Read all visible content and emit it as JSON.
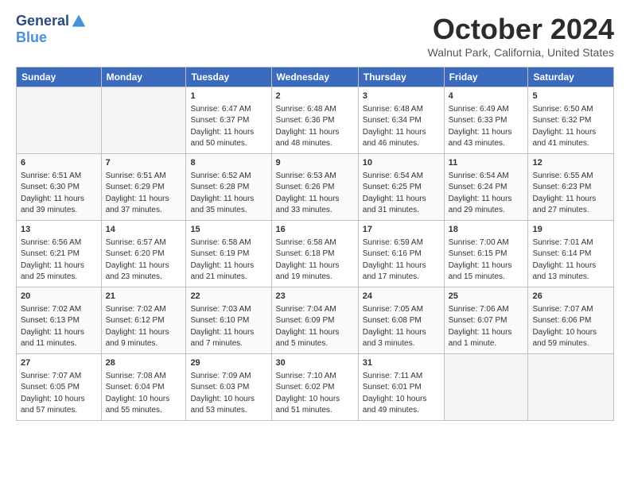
{
  "header": {
    "logo_general": "General",
    "logo_blue": "Blue",
    "month_title": "October 2024",
    "location": "Walnut Park, California, United States"
  },
  "days_of_week": [
    "Sunday",
    "Monday",
    "Tuesday",
    "Wednesday",
    "Thursday",
    "Friday",
    "Saturday"
  ],
  "weeks": [
    [
      {
        "num": "",
        "info": ""
      },
      {
        "num": "",
        "info": ""
      },
      {
        "num": "1",
        "info": "Sunrise: 6:47 AM\nSunset: 6:37 PM\nDaylight: 11 hours and 50 minutes."
      },
      {
        "num": "2",
        "info": "Sunrise: 6:48 AM\nSunset: 6:36 PM\nDaylight: 11 hours and 48 minutes."
      },
      {
        "num": "3",
        "info": "Sunrise: 6:48 AM\nSunset: 6:34 PM\nDaylight: 11 hours and 46 minutes."
      },
      {
        "num": "4",
        "info": "Sunrise: 6:49 AM\nSunset: 6:33 PM\nDaylight: 11 hours and 43 minutes."
      },
      {
        "num": "5",
        "info": "Sunrise: 6:50 AM\nSunset: 6:32 PM\nDaylight: 11 hours and 41 minutes."
      }
    ],
    [
      {
        "num": "6",
        "info": "Sunrise: 6:51 AM\nSunset: 6:30 PM\nDaylight: 11 hours and 39 minutes."
      },
      {
        "num": "7",
        "info": "Sunrise: 6:51 AM\nSunset: 6:29 PM\nDaylight: 11 hours and 37 minutes."
      },
      {
        "num": "8",
        "info": "Sunrise: 6:52 AM\nSunset: 6:28 PM\nDaylight: 11 hours and 35 minutes."
      },
      {
        "num": "9",
        "info": "Sunrise: 6:53 AM\nSunset: 6:26 PM\nDaylight: 11 hours and 33 minutes."
      },
      {
        "num": "10",
        "info": "Sunrise: 6:54 AM\nSunset: 6:25 PM\nDaylight: 11 hours and 31 minutes."
      },
      {
        "num": "11",
        "info": "Sunrise: 6:54 AM\nSunset: 6:24 PM\nDaylight: 11 hours and 29 minutes."
      },
      {
        "num": "12",
        "info": "Sunrise: 6:55 AM\nSunset: 6:23 PM\nDaylight: 11 hours and 27 minutes."
      }
    ],
    [
      {
        "num": "13",
        "info": "Sunrise: 6:56 AM\nSunset: 6:21 PM\nDaylight: 11 hours and 25 minutes."
      },
      {
        "num": "14",
        "info": "Sunrise: 6:57 AM\nSunset: 6:20 PM\nDaylight: 11 hours and 23 minutes."
      },
      {
        "num": "15",
        "info": "Sunrise: 6:58 AM\nSunset: 6:19 PM\nDaylight: 11 hours and 21 minutes."
      },
      {
        "num": "16",
        "info": "Sunrise: 6:58 AM\nSunset: 6:18 PM\nDaylight: 11 hours and 19 minutes."
      },
      {
        "num": "17",
        "info": "Sunrise: 6:59 AM\nSunset: 6:16 PM\nDaylight: 11 hours and 17 minutes."
      },
      {
        "num": "18",
        "info": "Sunrise: 7:00 AM\nSunset: 6:15 PM\nDaylight: 11 hours and 15 minutes."
      },
      {
        "num": "19",
        "info": "Sunrise: 7:01 AM\nSunset: 6:14 PM\nDaylight: 11 hours and 13 minutes."
      }
    ],
    [
      {
        "num": "20",
        "info": "Sunrise: 7:02 AM\nSunset: 6:13 PM\nDaylight: 11 hours and 11 minutes."
      },
      {
        "num": "21",
        "info": "Sunrise: 7:02 AM\nSunset: 6:12 PM\nDaylight: 11 hours and 9 minutes."
      },
      {
        "num": "22",
        "info": "Sunrise: 7:03 AM\nSunset: 6:10 PM\nDaylight: 11 hours and 7 minutes."
      },
      {
        "num": "23",
        "info": "Sunrise: 7:04 AM\nSunset: 6:09 PM\nDaylight: 11 hours and 5 minutes."
      },
      {
        "num": "24",
        "info": "Sunrise: 7:05 AM\nSunset: 6:08 PM\nDaylight: 11 hours and 3 minutes."
      },
      {
        "num": "25",
        "info": "Sunrise: 7:06 AM\nSunset: 6:07 PM\nDaylight: 11 hours and 1 minute."
      },
      {
        "num": "26",
        "info": "Sunrise: 7:07 AM\nSunset: 6:06 PM\nDaylight: 10 hours and 59 minutes."
      }
    ],
    [
      {
        "num": "27",
        "info": "Sunrise: 7:07 AM\nSunset: 6:05 PM\nDaylight: 10 hours and 57 minutes."
      },
      {
        "num": "28",
        "info": "Sunrise: 7:08 AM\nSunset: 6:04 PM\nDaylight: 10 hours and 55 minutes."
      },
      {
        "num": "29",
        "info": "Sunrise: 7:09 AM\nSunset: 6:03 PM\nDaylight: 10 hours and 53 minutes."
      },
      {
        "num": "30",
        "info": "Sunrise: 7:10 AM\nSunset: 6:02 PM\nDaylight: 10 hours and 51 minutes."
      },
      {
        "num": "31",
        "info": "Sunrise: 7:11 AM\nSunset: 6:01 PM\nDaylight: 10 hours and 49 minutes."
      },
      {
        "num": "",
        "info": ""
      },
      {
        "num": "",
        "info": ""
      }
    ]
  ]
}
